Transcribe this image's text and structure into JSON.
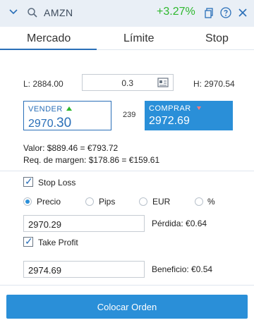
{
  "header": {
    "symbol": "AMZN",
    "change": "+3.27%"
  },
  "tabs": {
    "market": "Mercado",
    "limit": "Límite",
    "stop": "Stop"
  },
  "quote": {
    "low": "L: 2884.00",
    "quantity": "0.3",
    "high": "H: 2970.54",
    "sell_label": "VENDER",
    "sell_price": "2970.30",
    "spread": "239",
    "buy_label": "COMPRAR",
    "buy_price": "2972.69"
  },
  "summary": {
    "value": "Valor: $889.46 = €793.72",
    "margin": "Req. de margen: $178.86 = €159.61"
  },
  "stop_loss": {
    "label": "Stop Loss",
    "checked": true,
    "options": [
      "Precio",
      "Pips",
      "EUR",
      "%"
    ],
    "selected": "Precio",
    "price": "2970.29",
    "loss": "Pérdida: €0.64"
  },
  "take_profit": {
    "label": "Take Profit",
    "checked": true,
    "price": "2974.69",
    "profit": "Beneficio: €0.54"
  },
  "action": {
    "place_order": "Colocar Orden"
  }
}
